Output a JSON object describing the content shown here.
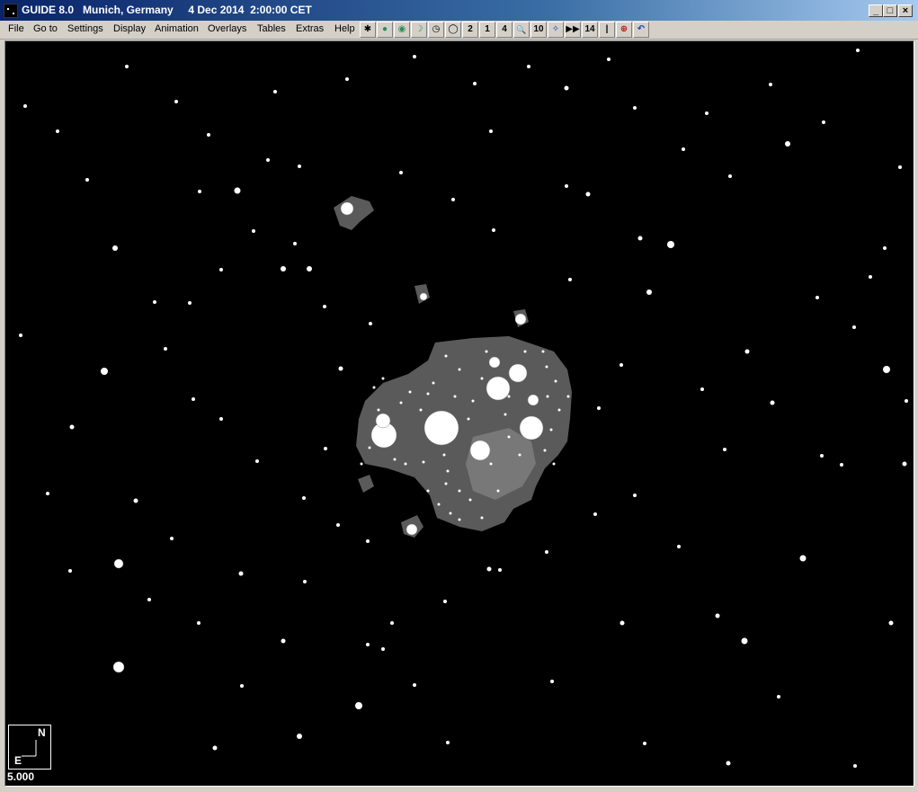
{
  "window": {
    "title": "GUIDE 8.0   Munich, Germany     4 Dec 2014  2:00:00 CET",
    "controls": [
      "_",
      "□",
      "×"
    ]
  },
  "menu": {
    "items": [
      "File",
      "Go to",
      "Settings",
      "Display",
      "Animation",
      "Overlays",
      "Tables",
      "Extras",
      "Help"
    ]
  },
  "toolbar": {
    "buttons": [
      {
        "icon": "telescope-icon",
        "glyph": "✱"
      },
      {
        "icon": "planet-icon",
        "glyph": "●"
      },
      {
        "icon": "sun-icon",
        "glyph": "◉"
      },
      {
        "icon": "moon-icon",
        "glyph": "☽"
      },
      {
        "icon": "clock-icon",
        "glyph": "◷"
      },
      {
        "icon": "zoom-out-icon",
        "glyph": "◯"
      },
      {
        "icon": "zoom-2-icon",
        "glyph": "2"
      },
      {
        "icon": "zoom-1-icon",
        "glyph": "1"
      },
      {
        "icon": "zoom-4-icon",
        "glyph": "4"
      },
      {
        "icon": "zoom-in-icon",
        "glyph": "🔍"
      },
      {
        "icon": "zoom-10-icon",
        "glyph": "10"
      },
      {
        "icon": "star-map-icon",
        "glyph": "✧"
      },
      {
        "icon": "fast-forward-icon",
        "glyph": "▶▶"
      },
      {
        "icon": "step-count-icon",
        "glyph": "14"
      },
      {
        "icon": "step-bar-icon",
        "glyph": "|"
      },
      {
        "icon": "target-icon",
        "glyph": "⊕"
      },
      {
        "icon": "undo-icon",
        "glyph": "↶"
      }
    ]
  },
  "chart": {
    "compass_north": "N",
    "compass_east": "E",
    "field_of_view": "5.000"
  },
  "colors": {
    "sky": "#000000",
    "nebula_outer": "#5a5a5a",
    "nebula_inner": "#787878",
    "star": "#ffffff",
    "titlebar_start": "#0a246a",
    "titlebar_end": "#a6caf0"
  }
}
